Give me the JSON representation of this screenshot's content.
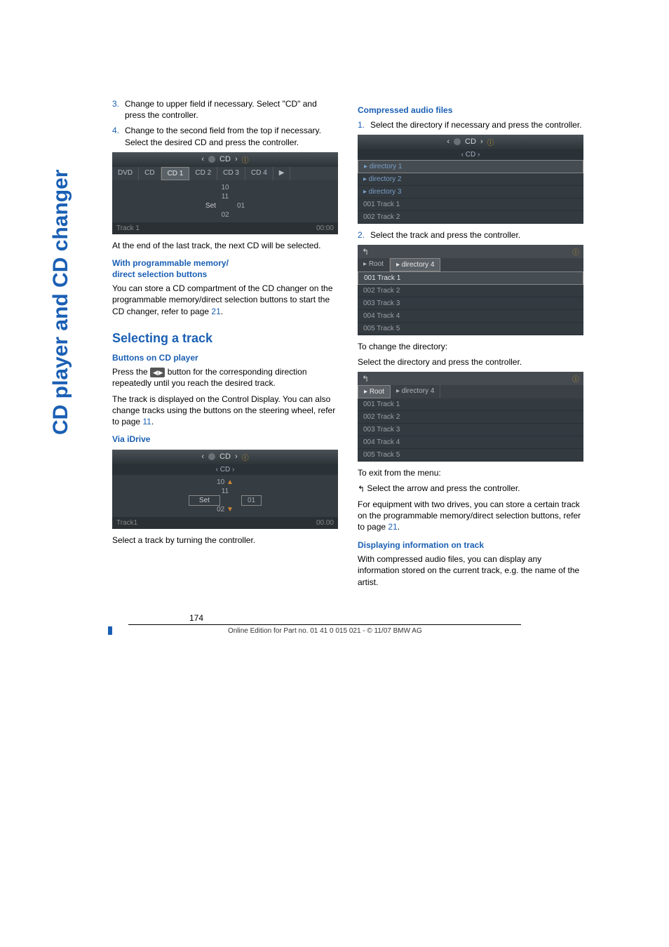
{
  "side_title": "CD player and CD changer",
  "left": {
    "steps_a": [
      {
        "n": "3.",
        "t": "Change to upper field if necessary. Select \"CD\" and press the controller."
      },
      {
        "n": "4.",
        "t": "Change to the second field from the top if necessary. Select the desired CD and press the controller."
      }
    ],
    "shot1": {
      "header": "CD",
      "tabs": [
        "DVD",
        "CD",
        "CD 1",
        "CD 2",
        "CD 3",
        "CD 4"
      ],
      "body_rows": [
        "10",
        "11",
        "01",
        "02"
      ],
      "set_label": "Set",
      "footer_left": "Track 1",
      "footer_right": "00:00"
    },
    "after_shot1": "At the end of the last track, the next CD will be selected.",
    "sub1_l1": "With programmable memory/",
    "sub1_l2": "direct selection buttons",
    "p_mem_a": "You can store a CD compartment of the CD changer on the programmable memory/direct selection buttons to start the CD changer, refer to page ",
    "p_mem_ref": "21",
    "p_mem_b": ".",
    "h2": "Selecting a track",
    "sub2": "Buttons on CD player",
    "p_btn_a": "Press the ",
    "btn_icon": "◀   ▶",
    "p_btn_b": " button for the corresponding direction repeatedly until you reach the desired track.",
    "p_btn2_a": "The track is displayed on the Control Display. You can also change tracks using the buttons on the steering wheel, refer to page ",
    "p_btn2_ref": "11",
    "p_btn2_b": ".",
    "sub3": "Via iDrive",
    "shot2": {
      "header": "CD",
      "sub": "CD",
      "body_rows": [
        "10",
        "11",
        "01",
        "02"
      ],
      "set_label": "Set",
      "footer_left": "Track1",
      "footer_right": "00.00"
    },
    "after_shot2": "Select a track by turning the controller."
  },
  "right": {
    "sub1": "Compressed audio files",
    "step1": {
      "n": "1.",
      "t": "Select the directory if necessary and press the controller."
    },
    "shot3": {
      "header": "CD",
      "sub": "CD",
      "items": [
        {
          "t": "directory 1",
          "cls": "dir sel"
        },
        {
          "t": "directory 2",
          "cls": "dir"
        },
        {
          "t": "directory 3",
          "cls": "dir"
        },
        {
          "t": "001 Track 1",
          "cls": ""
        },
        {
          "t": "002 Track 2",
          "cls": ""
        }
      ]
    },
    "step2": {
      "n": "2.",
      "t": "Select the track and press the controller."
    },
    "shot4": {
      "crumbs": [
        "Root",
        "directory 4"
      ],
      "items": [
        {
          "t": "001 Track 1",
          "cls": "sel"
        },
        {
          "t": "002 Track 2",
          "cls": ""
        },
        {
          "t": "003 Track 3",
          "cls": ""
        },
        {
          "t": "004 Track 4",
          "cls": ""
        },
        {
          "t": "005 Track 5",
          "cls": ""
        }
      ]
    },
    "p_change1": "To change the directory:",
    "p_change2": "Select the directory and press the controller.",
    "shot5": {
      "crumbs": [
        "Root",
        "directory 4"
      ],
      "items": [
        {
          "t": "001 Track 1",
          "cls": ""
        },
        {
          "t": "002 Track 2",
          "cls": ""
        },
        {
          "t": "003 Track 3",
          "cls": ""
        },
        {
          "t": "004 Track 4",
          "cls": ""
        },
        {
          "t": "005 Track 5",
          "cls": ""
        }
      ]
    },
    "p_exit1": "To exit from the menu:",
    "back_glyph": "↰",
    "p_exit2": " Select the arrow and press the controller.",
    "p_equip_a": "For equipment with two drives, you can store a certain track on the programmable memory/direct selection buttons, refer to page ",
    "p_equip_ref": "21",
    "p_equip_b": ".",
    "sub2": "Displaying information on track",
    "p_disp": "With compressed audio files, you can display any information stored on the current track, e.g. the name of the artist."
  },
  "footer": {
    "page": "174",
    "edition": "Online Edition for Part no. 01 41 0 015 021 - © 11/07 BMW AG"
  }
}
